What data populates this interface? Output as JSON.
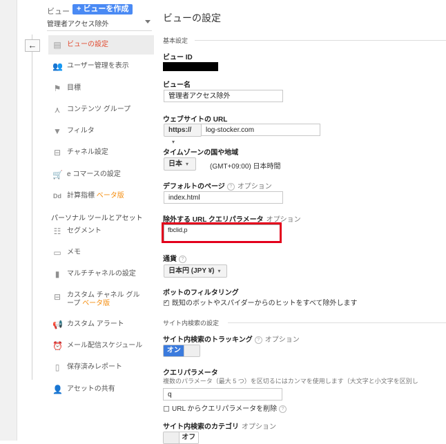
{
  "sidebar": {
    "view_label": "ビュー",
    "create_view_label": "ビューを作成",
    "selected_view": "管理者アクセス除外",
    "back_icon": "←",
    "items": [
      {
        "label": "ビューの設定",
        "icon": "document-icon",
        "glyph": "▤",
        "active": true
      },
      {
        "label": "ユーザー管理を表示",
        "icon": "users-icon",
        "glyph": "👥"
      },
      {
        "label": "目標",
        "icon": "flag-icon",
        "glyph": "⚑"
      },
      {
        "label": "コンテンツ グループ",
        "icon": "content-group-icon",
        "glyph": "⋏"
      },
      {
        "label": "フィルタ",
        "icon": "filter-icon",
        "glyph": "▼"
      },
      {
        "label": "チャネル設定",
        "icon": "channel-icon",
        "glyph": "⊟"
      },
      {
        "label": "e コマースの設定",
        "icon": "cart-icon",
        "glyph": "🛒"
      },
      {
        "label": "計算指標",
        "beta": "ベータ版",
        "icon": "dd-icon",
        "glyph": "Dd"
      }
    ],
    "personal_section": "パーソナル ツールとアセット",
    "personal_items": [
      {
        "label": "セグメント",
        "icon": "segment-icon",
        "glyph": "☷"
      },
      {
        "label": "メモ",
        "icon": "memo-icon",
        "glyph": "▭"
      },
      {
        "label": "マルチチャネルの設定",
        "icon": "bar-chart-icon",
        "glyph": "▮"
      },
      {
        "label1": "カスタム チャネル グル",
        "label2": "ープ",
        "beta": "ベータ版",
        "icon": "custom-channel-icon",
        "glyph": "⊟"
      },
      {
        "label": "カスタム アラート",
        "icon": "megaphone-icon",
        "glyph": "📢"
      },
      {
        "label": "メール配信スケジュール",
        "icon": "clock-icon",
        "glyph": "⏰"
      },
      {
        "label": "保存済みレポート",
        "icon": "saved-report-icon",
        "glyph": "▯"
      },
      {
        "label": "アセットの共有",
        "icon": "share-user-icon",
        "glyph": "👤"
      }
    ]
  },
  "main": {
    "title": "ビューの設定",
    "basic_settings": "基本設定",
    "view_id_label": "ビュー ID",
    "view_name_label": "ビュー名",
    "view_name_value": "管理者アクセス除外",
    "website_url_label": "ウェブサイトの URL",
    "protocol": "https://",
    "website_url_value": "log-stocker.com",
    "timezone_label": "タイムゾーンの国や地域",
    "country": "日本",
    "timezone": "(GMT+09:00) 日本時間",
    "default_page_label": "デフォルトのページ",
    "optional": "オプション",
    "default_page_value": "index.html",
    "exclude_params_label": "除外する URL クエリパラメータ",
    "exclude_params_value": "fbclid,p",
    "currency_label": "通貨",
    "currency_value": "日本円 (JPY ¥)",
    "bot_filter_label": "ボットのフィルタリング",
    "bot_filter_text": "既知のボットやスパイダーからのヒットをすべて除外します",
    "site_search_section": "サイト内検索の設定",
    "site_search_tracking_label": "サイト内検索のトラッキング",
    "toggle_on": "オン",
    "query_param_label": "クエリパラメータ",
    "query_param_desc": "複数のパラメータ（最大 5 つ）を区切るにはカンマを使用します（大文字と小文字を区別し",
    "query_param_value": "q",
    "strip_params_text": "URL からクエリパラメータを削除",
    "site_search_category_label": "サイト内検索のカテゴリ",
    "toggle_off": "オフ"
  }
}
